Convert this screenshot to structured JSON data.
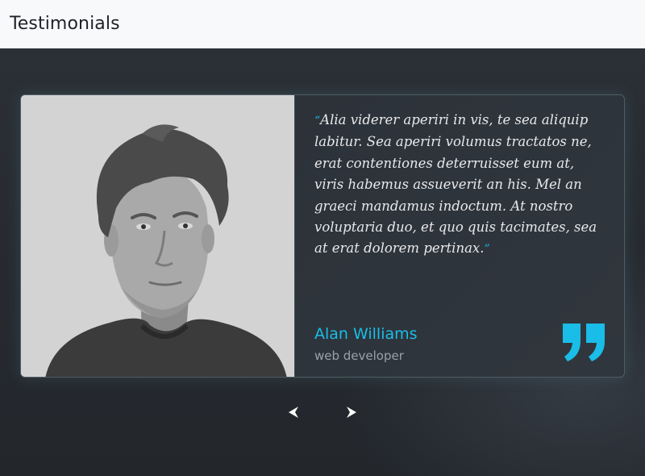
{
  "header": {
    "title": "Testimonials"
  },
  "testimonial": {
    "quote": "Alia viderer aperiri in vis, te sea aliquip labitur. Sea aperiri volumus tractatos ne, erat contentiones deterruisset eum at, viris habemus assueverit an his. Mel an graeci mandamus indoctum. At nostro voluptaria duo, et quo quis tacimates, sea at erat dolorem pertinax.",
    "open_mark": "“",
    "close_mark": "”",
    "author_name": "Alan Williams",
    "author_role": "web developer",
    "photo_icon": "person-portrait",
    "quote_icon": "closing-quote-icon"
  },
  "navigation": {
    "prev_icon": "chevron-left-icon",
    "next_icon": "chevron-right-icon"
  },
  "colors": {
    "accent": "#19bde7",
    "background": "#272b31",
    "header_bg": "#f8f9fb"
  }
}
